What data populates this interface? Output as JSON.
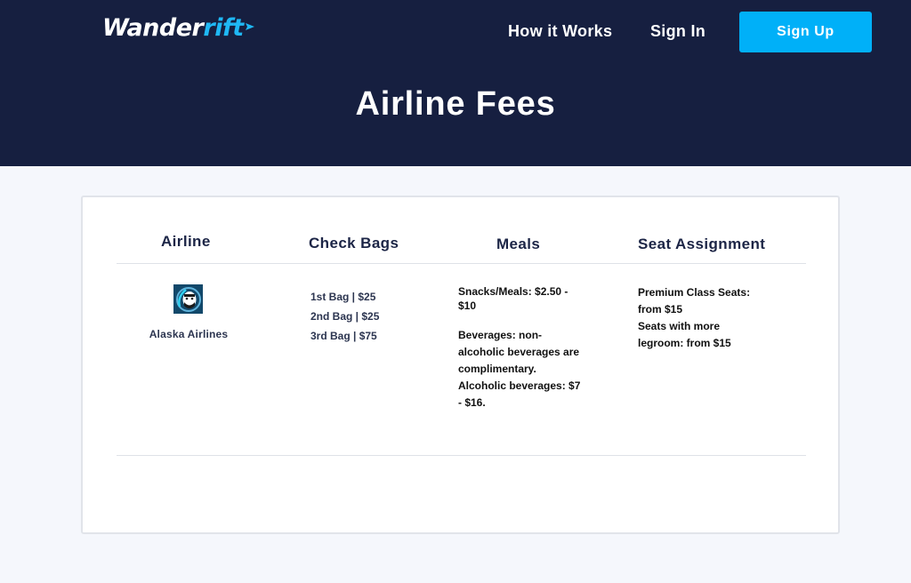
{
  "brand": {
    "name_main": "Wander",
    "name_accent": "ift",
    "name_dot": "r"
  },
  "nav": {
    "how_it_works": "How it Works",
    "sign_in": "Sign In",
    "sign_up": "Sign Up"
  },
  "page": {
    "title": "Airline Fees"
  },
  "table": {
    "headers": {
      "airline": "Airline",
      "check_bags": "Check Bags",
      "meals": "Meals",
      "seat_assignment": "Seat Assignment"
    },
    "rows": [
      {
        "airline": "Alaska Airlines",
        "bags": [
          "1st Bag | $25",
          "2nd Bag | $25",
          "3rd Bag | $75"
        ],
        "meals": {
          "snacks": "Snacks/Meals: $2.50 - $10",
          "beverages": "Beverages: non-alcoholic beverages are complimentary. Alcoholic beverages: $7 - $16."
        },
        "seats": {
          "premium": "Premium Class Seats: from $15",
          "legroom": "Seats with more legroom: from $15"
        }
      }
    ]
  },
  "colors": {
    "header_bg": "#161f40",
    "accent": "#00b0f8",
    "logo_accent": "#1fb8f5",
    "page_bg": "#f5f7fc"
  },
  "icons": {
    "logo_arrow": "arrow-icon",
    "airline_logo": "alaska-airlines-logo"
  }
}
